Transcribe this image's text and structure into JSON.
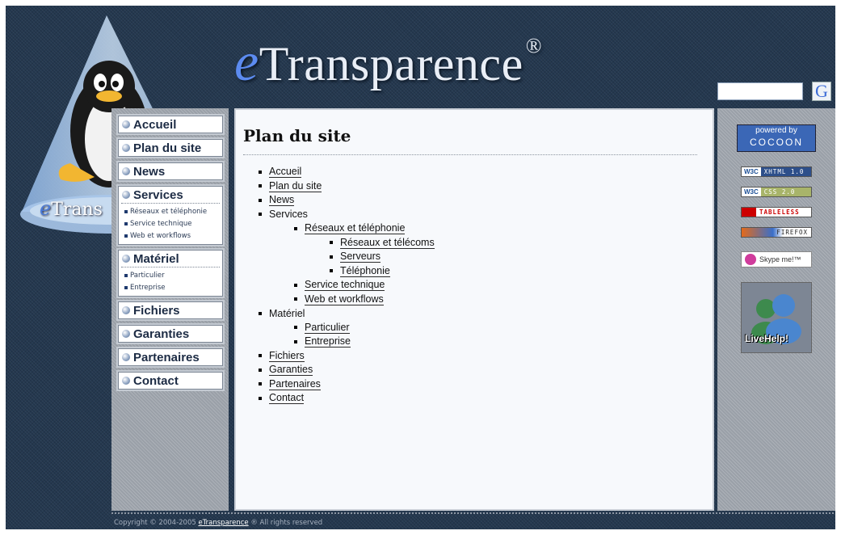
{
  "site": {
    "logo_letter": "e",
    "logo_rest": "Transparence",
    "logo_mark": "®",
    "cone_brand_letter": "e",
    "cone_brand_rest": "Trans"
  },
  "search": {
    "placeholder": "",
    "google_label": "G"
  },
  "nav": {
    "accueil": "Accueil",
    "plan": "Plan du site",
    "news": "News",
    "services": "Services",
    "services_sub": [
      "Réseaux et téléphonie",
      "Service technique",
      "Web et workflows"
    ],
    "materiel": "Matériel",
    "materiel_sub": [
      "Particulier",
      "Entreprise"
    ],
    "fichiers": "Fichiers",
    "garanties": "Garanties",
    "partenaires": "Partenaires",
    "contact": "Contact"
  },
  "main": {
    "title": "Plan du site",
    "sitemap": [
      {
        "label": "Accueil",
        "level": 0,
        "link": true
      },
      {
        "label": "Plan du site",
        "level": 0,
        "link": true
      },
      {
        "label": "News",
        "level": 0,
        "link": true
      },
      {
        "label": "Services",
        "level": 0,
        "link": false
      },
      {
        "label": "Réseaux et téléphonie",
        "level": 1,
        "link": true
      },
      {
        "label": "Réseaux et télécoms",
        "level": 2,
        "link": true
      },
      {
        "label": "Serveurs",
        "level": 2,
        "link": true
      },
      {
        "label": "Téléphonie",
        "level": 2,
        "link": true
      },
      {
        "label": "Service technique",
        "level": 1,
        "link": true
      },
      {
        "label": "Web et workflows",
        "level": 1,
        "link": true
      },
      {
        "label": "Matériel",
        "level": 0,
        "link": false
      },
      {
        "label": "Particulier",
        "level": 1,
        "link": true
      },
      {
        "label": "Entreprise",
        "level": 1,
        "link": true
      },
      {
        "label": "Fichiers",
        "level": 0,
        "link": true
      },
      {
        "label": "Garanties",
        "level": 0,
        "link": true
      },
      {
        "label": "Partenaires",
        "level": 0,
        "link": true
      },
      {
        "label": "Contact",
        "level": 0,
        "link": true
      }
    ]
  },
  "badges": {
    "cocoon_top": "powered by",
    "cocoon_bottom": "COCOON",
    "w3c": "W3C",
    "xhtml": "XHTML 1.0",
    "css": "CSS 2.0",
    "tableless": "TABLELESS",
    "firefox": "FIREFOX",
    "skype": "Skype me!™",
    "livehelp": "LiveHelp!"
  },
  "footer": {
    "prefix": "Copyright © 2004-2005",
    "link": "eTransparence",
    "suffix": "® All rights reserved"
  },
  "colors": {
    "background": "#24384f",
    "accent": "#5c8bf0",
    "sidebar": "#9aa0a8"
  }
}
